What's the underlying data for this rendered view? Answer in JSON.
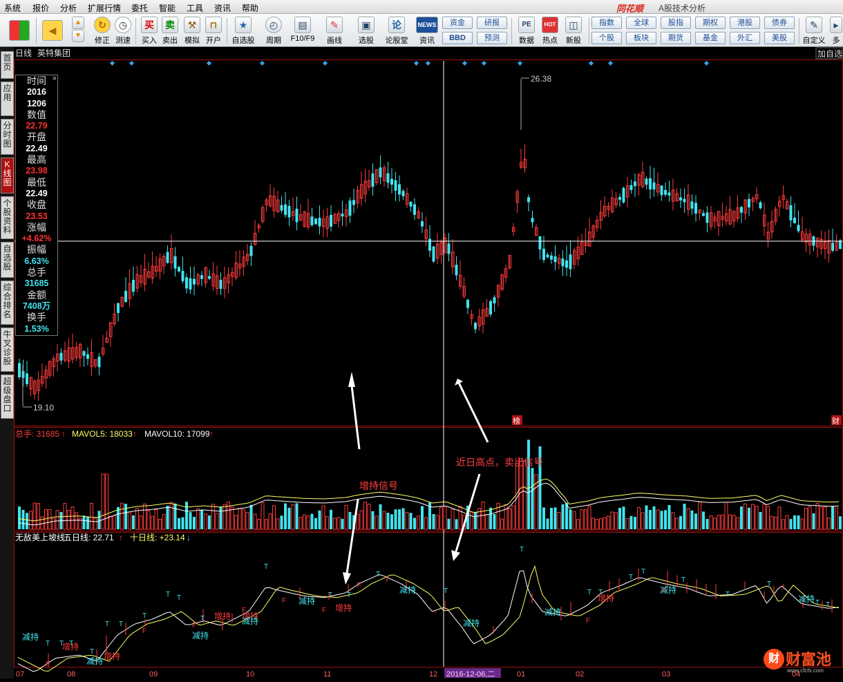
{
  "menu": {
    "items": [
      "系统",
      "报价",
      "分析",
      "扩展行情",
      "委托",
      "智能",
      "工具",
      "资讯",
      "帮助"
    ],
    "brand": "同花顺",
    "title": "A股技术分析"
  },
  "toolbar": {
    "buttons": [
      "修正",
      "测速",
      "买入",
      "卖出",
      "模拟",
      "开户",
      "自选股",
      "周期",
      "F10/F9",
      "画线",
      "选股",
      "论股堂",
      "资讯",
      "数据",
      "热点",
      "新股",
      "自定义",
      "多"
    ],
    "icon_text": {
      "buy": "买",
      "sell": "卖",
      "news": "NEWS",
      "pe": "PE",
      "hot": "HOT"
    },
    "grid": {
      "zijin": "资金",
      "bbd": "BBD",
      "yanbao": "研报",
      "yuce": "预测"
    },
    "markets": [
      "指数",
      "全球",
      "股指",
      "期权",
      "港股",
      "债券",
      "个股",
      "板块",
      "期货",
      "基金",
      "外汇",
      "美股"
    ]
  },
  "nav": [
    "首页",
    "应用",
    "分时图",
    "K线图",
    "个股资料",
    "自选股",
    "综合排名",
    "牛叉诊股",
    "超级盘口"
  ],
  "chart": {
    "period": "日线",
    "stock": "英特集团",
    "add_self": "加自选",
    "high_label": "26.38",
    "low_label": "19.10",
    "crosshair_date": "2016-12-06,二",
    "tag_bang": "榜",
    "tag_cai": "财",
    "months": [
      "07",
      "08",
      "09",
      "10",
      "11",
      "12",
      "01",
      "02",
      "03",
      "04"
    ]
  },
  "info": {
    "rows": [
      {
        "k": "时间",
        "v": "2016",
        "c": "w"
      },
      {
        "k": "",
        "v": "1206",
        "c": "w"
      },
      {
        "k": "数值",
        "v": "22.79",
        "c": "r"
      },
      {
        "k": "开盘",
        "v": "22.49",
        "c": "w"
      },
      {
        "k": "最高",
        "v": "23.98",
        "c": "r"
      },
      {
        "k": "最低",
        "v": "22.49",
        "c": "w"
      },
      {
        "k": "收盘",
        "v": "23.53",
        "c": "r"
      },
      {
        "k": "涨幅",
        "v": "+4.62%",
        "c": "r"
      },
      {
        "k": "振幅",
        "v": "6.63%",
        "c": "c"
      },
      {
        "k": "总手",
        "v": "31685",
        "c": "c"
      },
      {
        "k": "金额",
        "v": "7408万",
        "c": "c"
      },
      {
        "k": "换手",
        "v": "1.53%",
        "c": "c"
      }
    ]
  },
  "volume": {
    "zongshou": "总手: 31685",
    "ma5": "MAVOL5: 18033",
    "ma10": "MAVOL10: 17099"
  },
  "indicator": {
    "name": "无敌美上坡线",
    "five": "五日线: 22.71",
    "ten": "十日线: +23.14"
  },
  "annotations": {
    "buy": "增持信号",
    "sell": "近日高点，卖出信号"
  },
  "signals": {
    "reduce": "减持",
    "add": "增持",
    "T": "T",
    "F": "F"
  },
  "watermark": {
    "icon": "财",
    "name": "财富池",
    "url": "www.cfchi.com"
  },
  "colors": {
    "up": "#ff3b3b",
    "down": "#41e3ee",
    "ma5": "#ffff66",
    "ma10": "#ffffff",
    "frame": "#b01010",
    "diamond": "#3aa0e0"
  }
}
